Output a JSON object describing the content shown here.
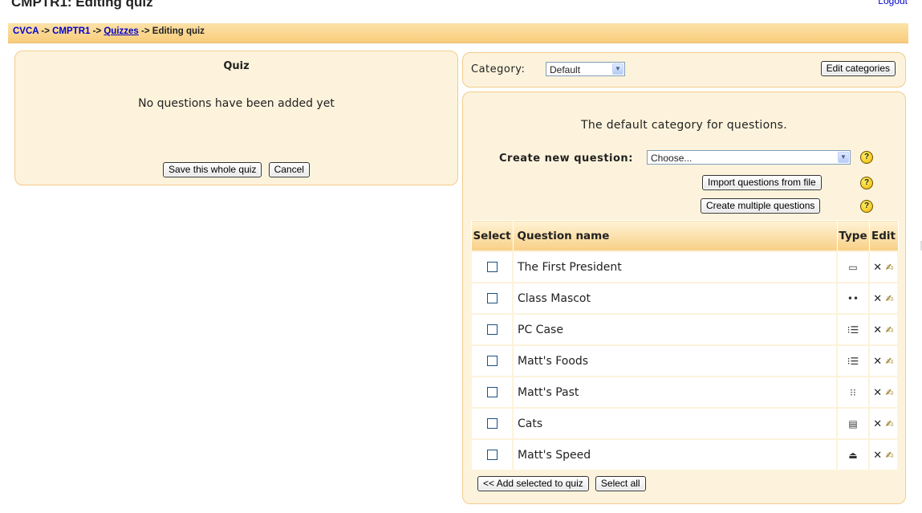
{
  "header": {
    "title": "CMPTR1: Editing quiz",
    "logout": "Logout"
  },
  "breadcrumb": {
    "items": [
      "CVCA",
      "CMPTR1",
      "Quizzes",
      "Editing quiz"
    ],
    "separator": "->"
  },
  "quiz_panel": {
    "heading": "Quiz",
    "empty_message": "No questions have been added yet",
    "save_button": "Save this whole quiz",
    "cancel_button": "Cancel"
  },
  "category_panel": {
    "label": "Category",
    "colon": ":",
    "selected": "Default",
    "edit_button": "Edit categories"
  },
  "question_bank": {
    "description": "The default category for questions.",
    "create_label": "Create new question",
    "create_placeholder": "Choose...",
    "help_glyph": "?",
    "import_button": "Import questions from file",
    "multiple_button": "Create multiple questions",
    "columns": {
      "select": "Select",
      "name": "Question name",
      "type": "Type",
      "edit": "Edit"
    },
    "questions": [
      {
        "name": "The First President",
        "type_icon": "shortanswer-icon",
        "type_glyph": "▭"
      },
      {
        "name": "Class Mascot",
        "type_icon": "truefalse-icon",
        "type_glyph": "••"
      },
      {
        "name": "PC Case",
        "type_icon": "multichoice-icon",
        "type_glyph": "⁝☰"
      },
      {
        "name": "Matt's Foods",
        "type_icon": "multichoice-icon",
        "type_glyph": "⁝☰"
      },
      {
        "name": "Matt's Past",
        "type_icon": "matching-icon",
        "type_glyph": "⁝⁝"
      },
      {
        "name": "Cats",
        "type_icon": "essay-icon",
        "type_glyph": "▤"
      },
      {
        "name": "Matt's Speed",
        "type_icon": "numerical-icon",
        "type_glyph": "⏏"
      }
    ],
    "delete_glyph": "✕",
    "edit_glyph": "✍",
    "add_selected_button": "<< Add selected to quiz",
    "select_all_button": "Select all"
  }
}
